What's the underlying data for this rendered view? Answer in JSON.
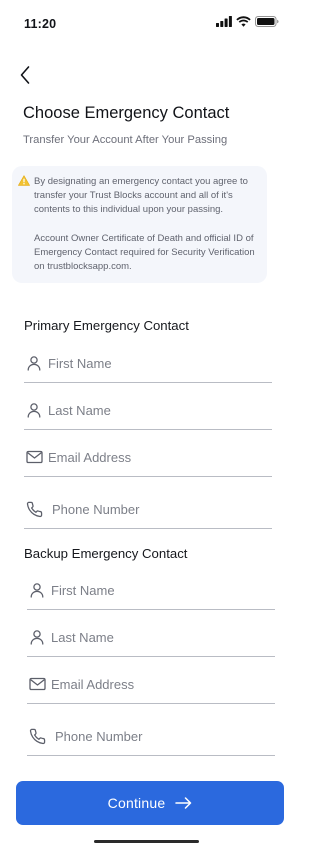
{
  "status_bar": {
    "time": "11:20",
    "icons": [
      "cellular-signal-icon",
      "wifi-icon",
      "battery-icon"
    ]
  },
  "header": {
    "back_icon": "chevron-left-icon",
    "title": "Choose Emergency Contact",
    "subtitle": "Transfer Your Account After Your Passing"
  },
  "notice": {
    "icon": "warning-icon",
    "paragraph_1": "By designating an emergency contact you agree to transfer your Trust Blocks account and all of it's contents to this individual upon your passing.",
    "paragraph_2": "Account Owner Certificate of Death and official ID of Emergency Contact required for Security Verification on trustblocksapp.com."
  },
  "primary_contact": {
    "heading": "Primary Emergency Contact",
    "first_name": {
      "value": "",
      "placeholder": "First Name"
    },
    "last_name": {
      "value": "",
      "placeholder": "Last Name"
    },
    "email": {
      "value": "",
      "placeholder": "Email Address"
    },
    "phone": {
      "value": "",
      "placeholder": "Phone Number"
    }
  },
  "backup_contact": {
    "heading": "Backup Emergency Contact",
    "first_name": {
      "value": "",
      "placeholder": "First Name"
    },
    "last_name": {
      "value": "",
      "placeholder": "Last Name"
    },
    "email": {
      "value": "",
      "placeholder": "Email Address"
    },
    "phone": {
      "value": "",
      "placeholder": "Phone Number"
    }
  },
  "continue_button": {
    "label": "Continue",
    "icon": "arrow-right-icon"
  },
  "colors": {
    "accent": "#2b69de",
    "warning": "#f1c232",
    "notice_background": "#f4f6fb"
  }
}
